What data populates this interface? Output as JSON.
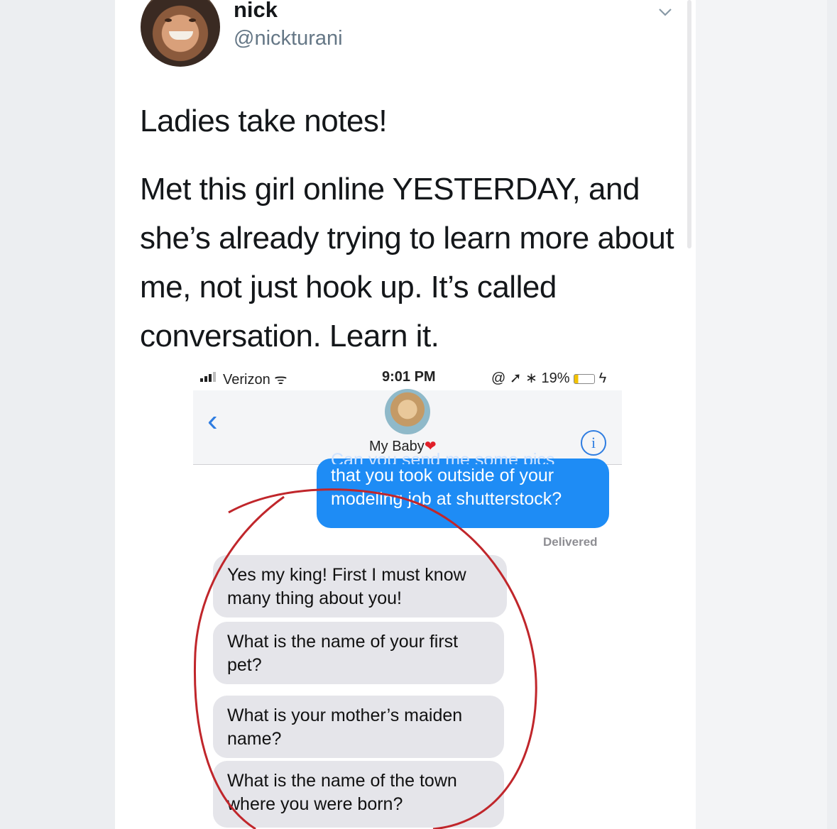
{
  "tweet": {
    "display_name": "nick",
    "handle": "@nickturani",
    "line1": "Ladies take notes!",
    "body": "Met this girl online YESTERDAY, and she’s already trying to learn more about me, not just hook up. It’s called conversation. Learn it."
  },
  "phone": {
    "status": {
      "carrier": "Verizon",
      "time": "9:01 PM",
      "battery": "19%"
    },
    "contact_name": "My Baby",
    "outgoing": {
      "cut_line": "Can you send me some pics",
      "text": "that you took outside of your modeling job at shutterstock?"
    },
    "delivered": "Delivered",
    "incoming": [
      "Yes my king! First I must know many thing about you!",
      "What is the name of your first pet?",
      "What is your mother’s maiden name?",
      "What is the name of the town where you were born?"
    ]
  },
  "colors": {
    "bubble_blue": "#1e8cf5",
    "bubble_gray": "#e5e5ea",
    "annotation_red": "#c0262b"
  },
  "icons": [
    "chevron-down-icon",
    "signal-bars-icon",
    "wifi-icon",
    "back-chevron-icon",
    "info-icon",
    "heart-icon"
  ]
}
